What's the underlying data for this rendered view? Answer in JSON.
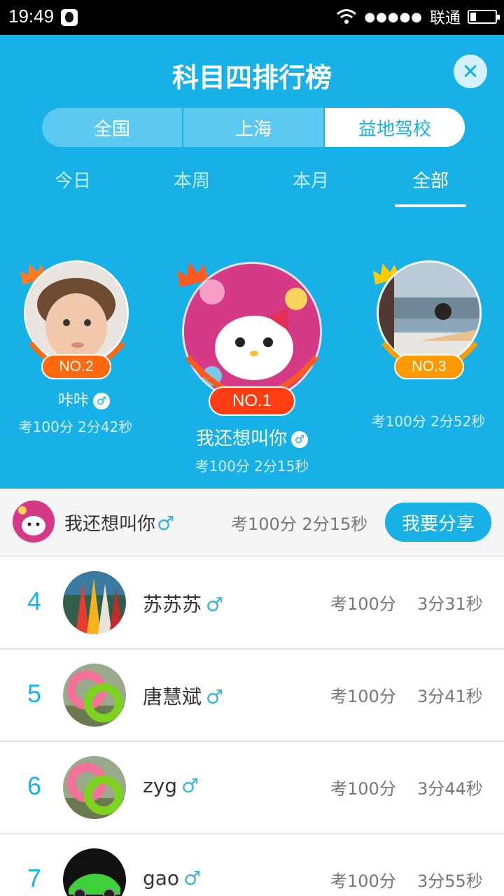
{
  "status_bar": {
    "time": "19:49",
    "carrier": "联通",
    "signal": "●●●●●"
  },
  "header": {
    "title": "科目四排行榜",
    "scope_tabs": [
      {
        "label": "全国",
        "active": false
      },
      {
        "label": "上海",
        "active": false
      },
      {
        "label": "益地驾校",
        "active": true
      }
    ],
    "period_tabs": [
      {
        "label": "今日",
        "active": false
      },
      {
        "label": "本周",
        "active": false
      },
      {
        "label": "本月",
        "active": false
      },
      {
        "label": "全部",
        "active": true
      }
    ]
  },
  "podium": {
    "first": {
      "badge": "NO.1",
      "name": "我还想叫你",
      "score": "考100分 2分15秒",
      "crown_color": "#ff5a1f",
      "badge_color": "#ff3d12"
    },
    "second": {
      "badge": "NO.2",
      "name": "咔咔",
      "score": "考100分 2分42秒",
      "crown_color": "#ff7a21",
      "badge_color": "#ff6a10"
    },
    "third": {
      "badge": "NO.3",
      "score": "考100分 2分52秒",
      "crown_color": "#ffcc00",
      "badge_color": "#ff9a00"
    }
  },
  "gender_symbol": "♂",
  "my_rank": {
    "name": "我还想叫你",
    "score": "考100分 2分15秒",
    "share_label": "我要分享"
  },
  "list": [
    {
      "rank": "4",
      "name": "苏苏苏",
      "score": "考100分",
      "time": "3分31秒"
    },
    {
      "rank": "5",
      "name": "唐慧斌",
      "score": "考100分",
      "time": "3分41秒"
    },
    {
      "rank": "6",
      "name": "zyg",
      "score": "考100分",
      "time": "3分44秒"
    },
    {
      "rank": "7",
      "name": "gao",
      "score": "考100分",
      "time": "3分55秒"
    }
  ],
  "colors": {
    "primary": "#17b1e8",
    "white": "#ffffff"
  }
}
